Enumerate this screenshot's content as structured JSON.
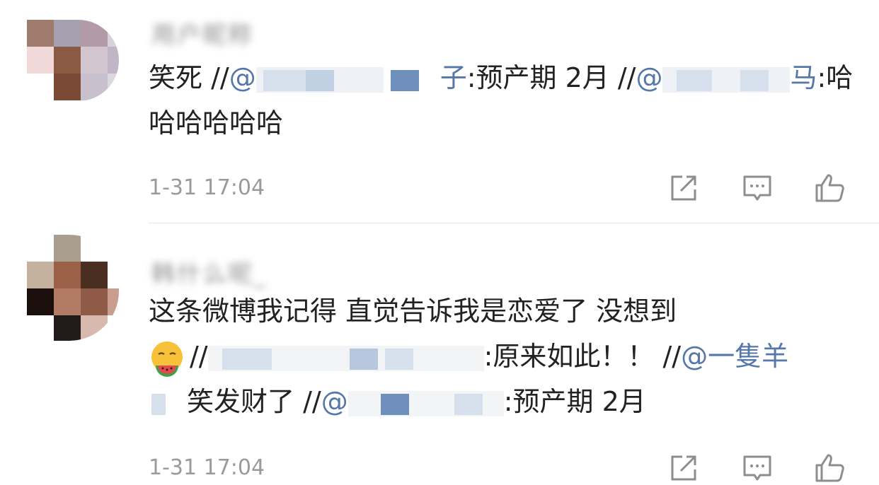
{
  "comments": [
    {
      "username": "用户昵称",
      "text_lead": "笑死 //",
      "mention1": "@",
      "mention1_tail": "子",
      "mid_text": ":预产期 2月 //",
      "mention2": "@",
      "mention2_tail": "马",
      "tail_text": ":哈",
      "line2": "哈哈哈哈哈",
      "time": "1-31 17:04"
    },
    {
      "username": "韩什么呢_",
      "line1": "这条微博我记得 直觉告诉我是恋爱了 没想到",
      "line2_sep": "//",
      "line2_mid": ":原来如此！！ //",
      "line2_mention": "@一隻羊",
      "line3_lead": "笑发财了 //",
      "line3_mention": "@",
      "line3_tail": ":预产期 2月",
      "time": "1-31 17:04"
    }
  ],
  "icons": {
    "share": "share-icon",
    "comment": "comment-icon",
    "like": "like-icon"
  },
  "colors": {
    "mention": "#5577aa",
    "meta": "#9a9a9a",
    "icon": "#8e8e8e"
  }
}
